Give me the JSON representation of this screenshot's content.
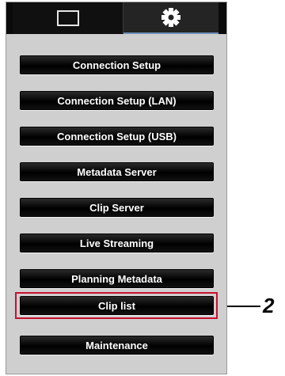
{
  "tabs": [
    {
      "icon": "monitor-icon"
    },
    {
      "icon": "gear-icon",
      "active": true
    }
  ],
  "menu": {
    "items": [
      {
        "label": "Connection Setup"
      },
      {
        "label": "Connection Setup (LAN)"
      },
      {
        "label": "Connection Setup (USB)"
      },
      {
        "label": "Metadata Server"
      },
      {
        "label": "Clip Server"
      },
      {
        "label": "Live Streaming"
      },
      {
        "label": "Planning Metadata"
      },
      {
        "label": "Clip list",
        "highlighted": true
      },
      {
        "label": "Maintenance"
      }
    ]
  },
  "callout": {
    "number": "2"
  },
  "colors": {
    "highlight": "#c8102e",
    "tab_accent": "#6f8fb8",
    "button_bg": "#000000"
  }
}
